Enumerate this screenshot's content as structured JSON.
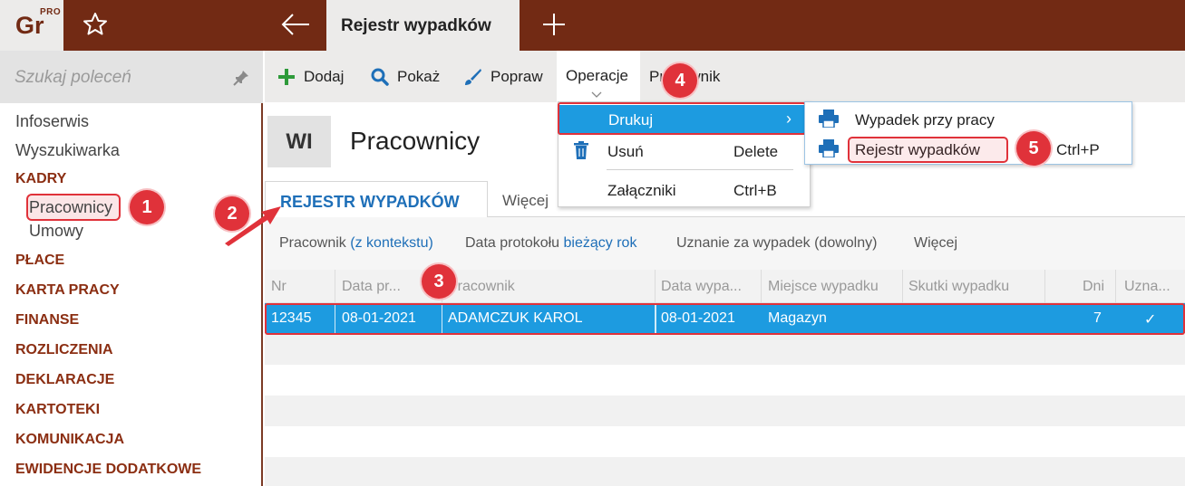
{
  "app": {
    "logo_text": "Gr",
    "logo_badge": "PRO",
    "active_tab": "Rejestr wypadków"
  },
  "sidebar": {
    "search_placeholder": "Szukaj poleceń",
    "items": [
      {
        "label": "Infoserwis",
        "kind": "item"
      },
      {
        "label": "Wyszukiwarka",
        "kind": "item"
      },
      {
        "label": "KADRY",
        "kind": "category"
      },
      {
        "label": "Pracownicy",
        "kind": "sub",
        "selected": true
      },
      {
        "label": "Umowy",
        "kind": "sub"
      },
      {
        "label": "PŁACE",
        "kind": "category"
      },
      {
        "label": "KARTA PRACY",
        "kind": "category"
      },
      {
        "label": "FINANSE",
        "kind": "category"
      },
      {
        "label": "ROZLICZENIA",
        "kind": "category"
      },
      {
        "label": "DEKLARACJE",
        "kind": "category"
      },
      {
        "label": "KARTOTEKI",
        "kind": "category"
      },
      {
        "label": "KOMUNIKACJA",
        "kind": "category"
      },
      {
        "label": "EWIDENCJE DODATKOWE",
        "kind": "category"
      }
    ]
  },
  "toolbar": {
    "add": "Dodaj",
    "show": "Pokaż",
    "edit": "Popraw",
    "operations": "Operacje",
    "employee": "Pracownik"
  },
  "header": {
    "badge": "WI",
    "title": "Pracownicy"
  },
  "tabs": {
    "active": "REJESTR WYPADKÓW",
    "more": "Więcej"
  },
  "filters": [
    {
      "label": "Pracownik",
      "value": "(z kontekstu)"
    },
    {
      "label": "Data protokołu",
      "value": "bieżący rok"
    },
    {
      "label": "Uznanie za wypadek (dowolny)",
      "value": ""
    },
    {
      "label": "Więcej",
      "value": ""
    }
  ],
  "grid": {
    "columns": [
      "Nr",
      "Data pr...",
      "Pracownik",
      "Data wypa...",
      "Miejsce wypadku",
      "Skutki wypadku",
      "Dni",
      "Uzna..."
    ],
    "rows": [
      {
        "nr": "12345",
        "data_protokolu": "08-01-2021",
        "pracownik": "ADAMCZUK KAROL",
        "data_wypadku": "08-01-2021",
        "miejsce": "Magazyn",
        "skutki": "",
        "dni": "7",
        "uznanie": "✓"
      }
    ]
  },
  "operations_menu": {
    "print": "Drukuj",
    "delete": "Usuń",
    "delete_shortcut": "Delete",
    "attachments": "Załączniki",
    "attachments_shortcut": "Ctrl+B"
  },
  "print_submenu": {
    "item1": "Wypadek przy pracy",
    "item2": "Rejestr wypadków",
    "item2_shortcut": "Ctrl+P"
  },
  "annotations": [
    "1",
    "2",
    "3",
    "4",
    "5"
  ],
  "colors": {
    "brand": "#722a14",
    "accent": "#1d9be0",
    "category": "#8b2e12",
    "link": "#1e6fb8",
    "highlight": "#e0323a"
  }
}
